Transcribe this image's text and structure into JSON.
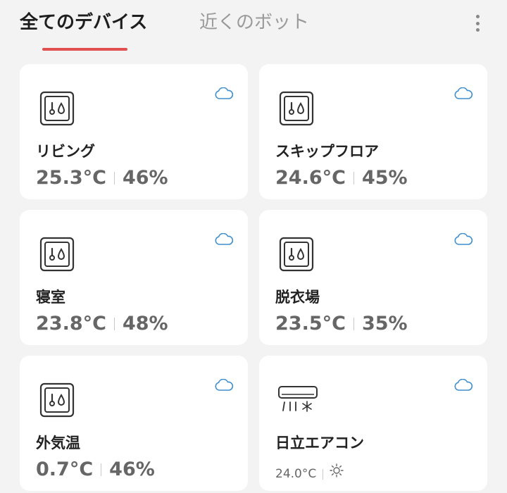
{
  "tabs": [
    {
      "label": "全てのデバイス",
      "active": true
    },
    {
      "label": "近くのボット",
      "active": false
    }
  ],
  "accent_color": "#e05050",
  "devices": [
    {
      "name": "リビング",
      "temperature": "25.3°C",
      "humidity": "46%",
      "icon": "thermo-hygrometer-icon",
      "status_icon": "cloud-icon"
    },
    {
      "name": "スキップフロア",
      "temperature": "24.6°C",
      "humidity": "45%",
      "icon": "thermo-hygrometer-icon",
      "status_icon": "cloud-icon"
    },
    {
      "name": "寝室",
      "temperature": "23.8°C",
      "humidity": "48%",
      "icon": "thermo-hygrometer-icon",
      "status_icon": "cloud-icon"
    },
    {
      "name": "脱衣場",
      "temperature": "23.5°C",
      "humidity": "35%",
      "icon": "thermo-hygrometer-icon",
      "status_icon": "cloud-icon"
    },
    {
      "name": "外気温",
      "temperature": "0.7°C",
      "humidity": "46%",
      "icon": "thermo-hygrometer-icon",
      "status_icon": "cloud-icon"
    },
    {
      "name": "日立エアコン",
      "temperature": "24.0°C",
      "mode_icon": "sun-icon",
      "icon": "air-conditioner-icon",
      "status_icon": "cloud-icon"
    }
  ]
}
